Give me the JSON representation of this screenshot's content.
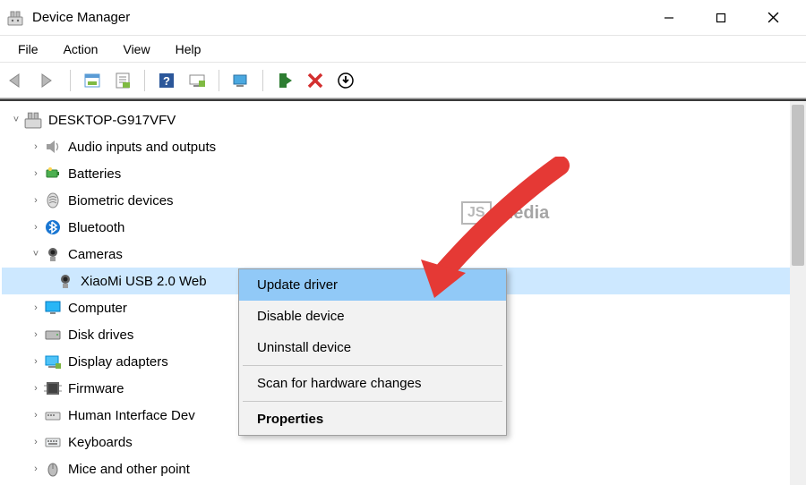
{
  "window": {
    "title": "Device Manager"
  },
  "menubar": {
    "items": [
      "File",
      "Action",
      "View",
      "Help"
    ]
  },
  "tree": {
    "root": "DESKTOP-G917VFV",
    "nodes": [
      {
        "label": "Audio inputs and outputs",
        "expanded": false
      },
      {
        "label": "Batteries",
        "expanded": false
      },
      {
        "label": "Biometric devices",
        "expanded": false
      },
      {
        "label": "Bluetooth",
        "expanded": false
      },
      {
        "label": "Cameras",
        "expanded": true,
        "children": [
          {
            "label": "XiaoMi USB 2.0 Web",
            "selected": true
          }
        ]
      },
      {
        "label": "Computer",
        "expanded": false
      },
      {
        "label": "Disk drives",
        "expanded": false
      },
      {
        "label": "Display adapters",
        "expanded": false
      },
      {
        "label": "Firmware",
        "expanded": false
      },
      {
        "label": "Human Interface Dev",
        "expanded": false
      },
      {
        "label": "Keyboards",
        "expanded": false
      },
      {
        "label": "Mice and other point",
        "expanded": false
      }
    ]
  },
  "context_menu": {
    "items": [
      {
        "label": "Update driver",
        "highlighted": true
      },
      {
        "label": "Disable device"
      },
      {
        "label": "Uninstall device"
      },
      {
        "sep": true
      },
      {
        "label": "Scan for hardware changes"
      },
      {
        "sep": true
      },
      {
        "label": "Properties",
        "bold": true
      }
    ]
  },
  "watermark": {
    "badge": "JS",
    "text": "Media"
  }
}
